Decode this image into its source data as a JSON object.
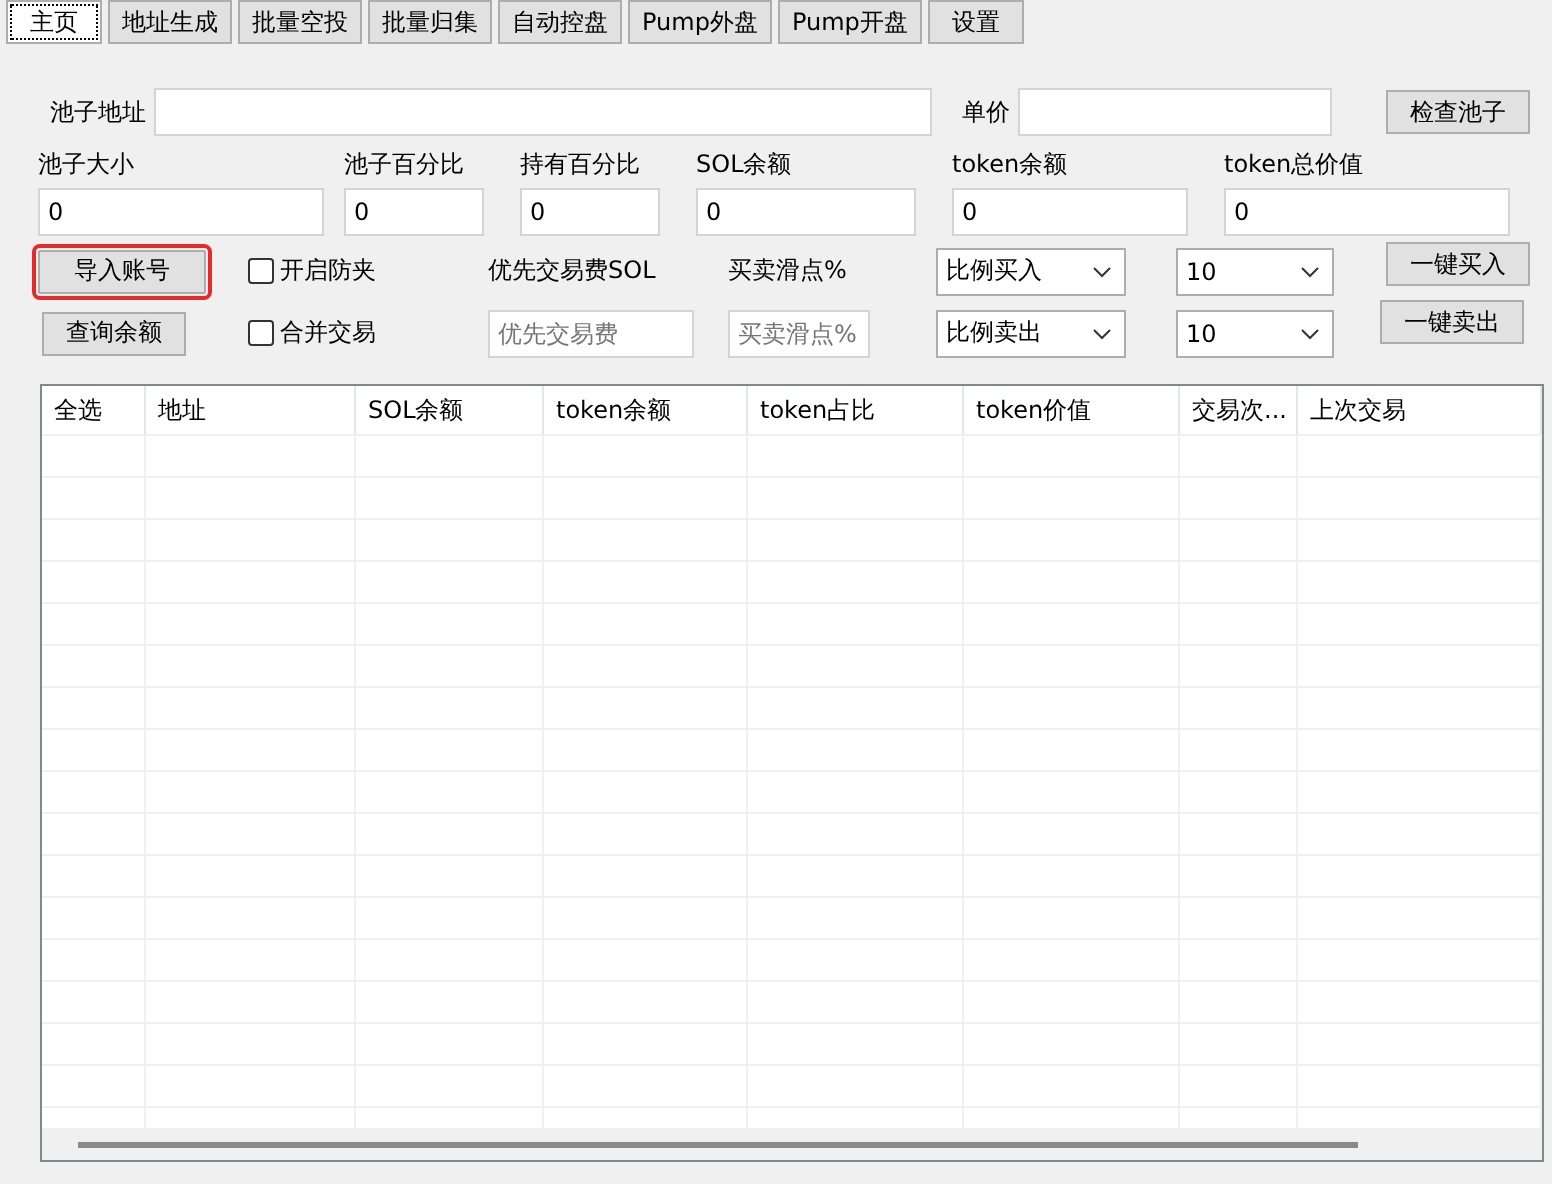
{
  "tabs": [
    {
      "label": "主页",
      "selected": true
    },
    {
      "label": "地址生成",
      "selected": false
    },
    {
      "label": "批量空投",
      "selected": false
    },
    {
      "label": "批量归集",
      "selected": false
    },
    {
      "label": "自动控盘",
      "selected": false
    },
    {
      "label": "Pump外盘",
      "selected": false
    },
    {
      "label": "Pump开盘",
      "selected": false
    },
    {
      "label": "设置",
      "selected": false
    }
  ],
  "pool_address": {
    "label": "池子地址"
  },
  "unit_price": {
    "label": "单价"
  },
  "check_pool_button": "检查池子",
  "stats": [
    {
      "label": "池子大小",
      "value": "0"
    },
    {
      "label": "池子百分比",
      "value": "0"
    },
    {
      "label": "持有百分比",
      "value": "0"
    },
    {
      "label": "SOL余额",
      "value": "0"
    },
    {
      "label": "token余额",
      "value": "0"
    },
    {
      "label": "token总价值",
      "value": "0"
    }
  ],
  "import_button": {
    "label": "导入账号",
    "highlighted": true
  },
  "query_button": "查询余额",
  "checkboxes": [
    {
      "label": "开启防夹",
      "checked": false
    },
    {
      "label": "合并交易",
      "checked": false
    }
  ],
  "priority_fee": {
    "label": "优先交易费SOL",
    "placeholder": "优先交易费"
  },
  "slippage": {
    "label": "买卖滑点%",
    "placeholder": "买卖滑点%"
  },
  "buy": {
    "mode": "比例买入",
    "amount": "10",
    "button": "一键买入"
  },
  "sell": {
    "mode": "比例卖出",
    "amount": "10",
    "button": "一键卖出"
  },
  "table": {
    "columns": [
      "全选",
      "地址",
      "SOL余额",
      "token余额",
      "token占比",
      "token价值",
      "交易次...",
      "上次交易"
    ]
  }
}
